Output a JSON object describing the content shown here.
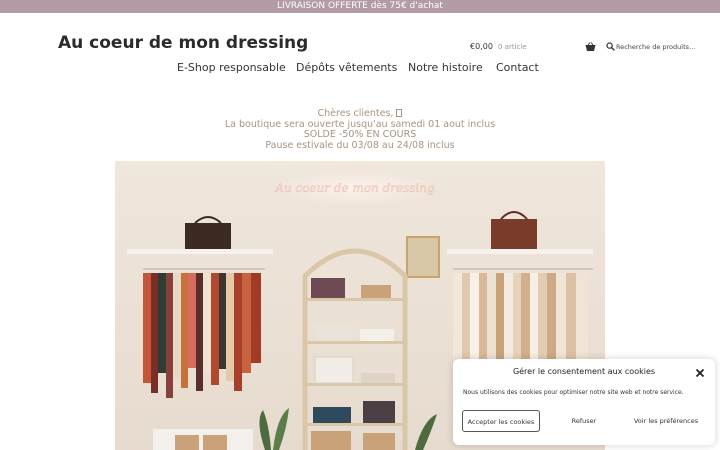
{
  "topbar": {
    "text": "LIVRAISON OFFERTE dès 75€ d'achat"
  },
  "header": {
    "site_title": "Au coeur de mon dressing",
    "cart_total": "€0,00",
    "cart_count": "0 article",
    "search_placeholder": "Recherche de produits…"
  },
  "nav": {
    "items": [
      {
        "label": "E-Shop responsable"
      },
      {
        "label": "Dépôts vêtements"
      },
      {
        "label": "Notre histoire"
      },
      {
        "label": "Contact"
      }
    ]
  },
  "notice": {
    "lines": [
      "Chères clientes, ",
      "La boutique sera ouverte jusqu'au samedi 01 aout inclus",
      "SOLDE -50% EN COURS",
      "Pause estivale du 03/08 au 24/08 inclus"
    ]
  },
  "hero": {
    "sign_text": "Au coeur de mon dressing"
  },
  "cookie_banner": {
    "title": "Gérer le consentement aux cookies",
    "text": "Nous utilisons des cookies pour optimiser notre site web et notre service.",
    "accept_label": "Accepter les cookies",
    "refuse_label": "Refuser",
    "prefs_label": "Voir les préférences"
  },
  "colors": {
    "topbar_bg": "#b39aa7",
    "notice_text": "#a89380",
    "wall": "#ece3d9"
  },
  "icons": [
    "basket-icon",
    "search-icon",
    "close-icon"
  ]
}
